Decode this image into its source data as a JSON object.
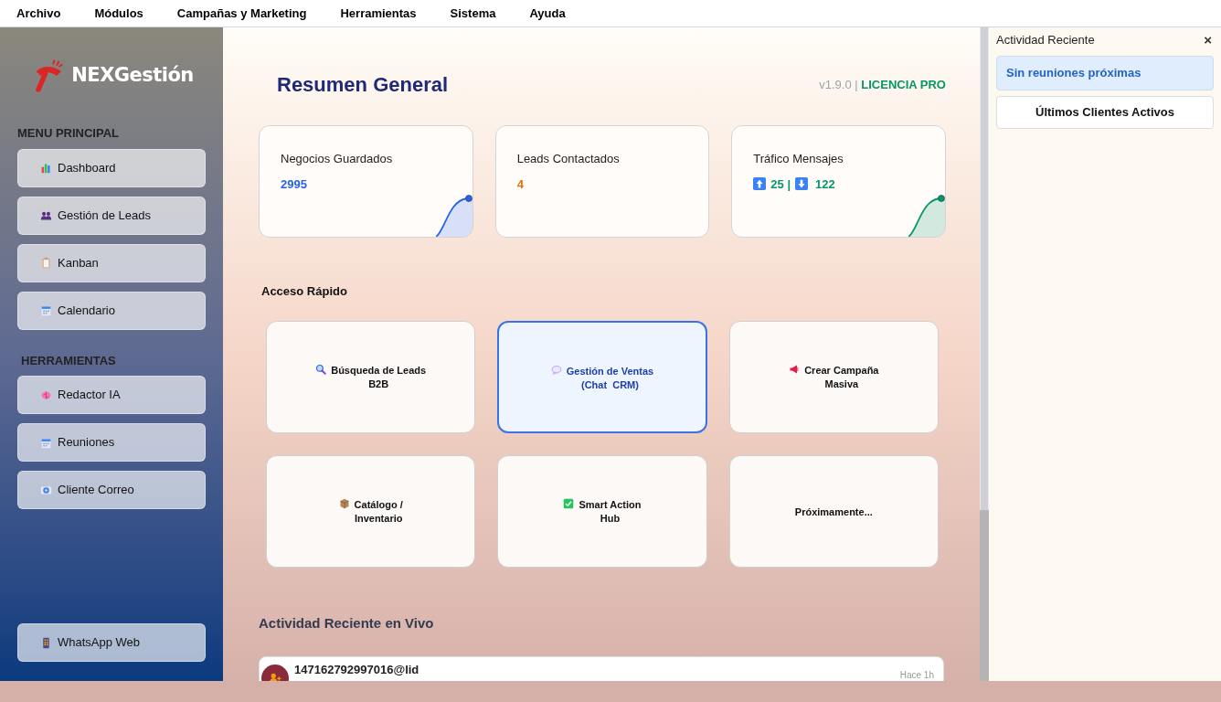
{
  "menu_bar": [
    "Archivo",
    "Módulos",
    "Campañas y Marketing",
    "Herramientas",
    "Sistema",
    "Ayuda"
  ],
  "sidebar": {
    "logo_text": "NEXGestión",
    "sections": [
      {
        "title": "MENU PRINCIPAL",
        "items": [
          {
            "label": "Dashboard"
          },
          {
            "label": "Gestión de Leads"
          },
          {
            "label": "Kanban"
          },
          {
            "label": "Calendario"
          }
        ]
      },
      {
        "title": "HERRAMIENTAS",
        "items": [
          {
            "label": "Redactor IA"
          },
          {
            "label": "Reuniones"
          },
          {
            "label": "Cliente Correo"
          }
        ]
      }
    ],
    "bottom_item": {
      "label": "WhatsApp Web"
    }
  },
  "header": {
    "title": "Resumen General",
    "version": "v1.9.0",
    "separator": "|",
    "license": "LICENCIA PRO"
  },
  "stats": [
    {
      "title": "Negocios Guardados",
      "kind": "single",
      "value": "2995",
      "color": "#2563eb",
      "sparkline": true
    },
    {
      "title": "Leads Contactados",
      "kind": "single",
      "value": "4",
      "color": "#d97706",
      "sparkline": false
    },
    {
      "title": "Tráfico Mensajes",
      "kind": "traffic",
      "sent": "25",
      "separator": "|",
      "received": "122",
      "color": "#059669",
      "sparkline": true
    }
  ],
  "quick_access": {
    "title": "Acceso Rápido",
    "tiles": [
      {
        "label": "Búsqueda de Leads\nB2B",
        "selected": false
      },
      {
        "label": "Gestión de Ventas\n(Chat  CRM)",
        "selected": true
      },
      {
        "label": "Crear Campaña\nMasiva",
        "selected": false
      },
      {
        "label": "Catálogo /\nInventario",
        "selected": false
      },
      {
        "label": "Smart Action\nHub",
        "selected": false
      },
      {
        "label": "Próximamente...",
        "selected": false
      }
    ]
  },
  "live_activity": {
    "title": "Actividad Reciente en Vivo",
    "items": [
      {
        "name": "147162792997016@lid",
        "time": "Hace 1h"
      }
    ]
  },
  "right_panel": {
    "title": "Actividad Reciente",
    "close": "×",
    "meetings": "Sin reuniones próximas",
    "clients": "Últimos Clientes Activos"
  }
}
